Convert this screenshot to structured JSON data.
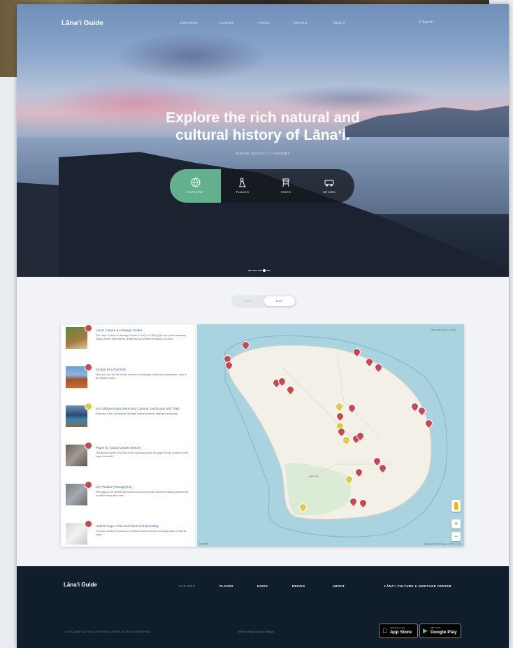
{
  "site": {
    "logo": "Lāna‘i Guide",
    "nav": [
      "Explore",
      "Places",
      "Hikes",
      "Drives",
      "About"
    ],
    "search_placeholder": "Search"
  },
  "hero": {
    "title_line1": "Explore the rich natural and",
    "title_line2": "cultural history of Lāna‘i.",
    "subtitle": "Please select a category",
    "tabs": [
      {
        "label": "Explore",
        "icon": "globe-icon",
        "active": true
      },
      {
        "label": "Places",
        "icon": "person-pin-icon",
        "active": false
      },
      {
        "label": "Hikes",
        "icon": "hiking-icon",
        "active": false
      },
      {
        "label": "Drives",
        "icon": "jeep-icon",
        "active": false
      }
    ],
    "slides_count": 5,
    "active_slide": 3
  },
  "view_toggle": {
    "options": [
      "List",
      "Map"
    ],
    "selected": "Map"
  },
  "places_list": [
    {
      "title": "Lāna‘i Culture & Heritage Center",
      "description": "The Lāna‘i Culture & Heritage Center (LCHC) is a 501(c)(3) non-profit community history center that collects, preserves and shares the history of Lāna‘i.",
      "badge": "red"
    },
    {
      "title": "Ka‘ōpū Koa Overlook",
      "description": "Here you can see the rusted remains of pineapple trucks and a panoramic view of the eastern slope.",
      "badge": "red"
    },
    {
      "title": "Ka Lokelani Kapu (Keomoku Cultural Landscape and Trail)",
      "description": "Keomoku Kapu (Keomoku) Heritage Trail and historic fishpond landscape.",
      "badge": "yellow"
    },
    {
      "title": "Paper by (Gand Garden Beach)",
      "description": "The ancient game of Ke‘aki Lē‘ahu‘i (sports) use to be played at this location on the way to Kaunolū.",
      "badge": "red"
    },
    {
      "title": "Kiʻi Pōhaku (Petroglyphs)",
      "description": "Petroglyphs are etched into rocks to record important events or natural phenomena in places along the coast.",
      "badge": "red"
    },
    {
      "title": "Halēʻiki Kapu: Trail and Ruins and Boundary",
      "description": "This site contains remnants of a historic settlement and boundary walls of Halēʻiki Kapu.",
      "badge": "red"
    }
  ],
  "map": {
    "label": "Maunalei Gulch Forest",
    "town_label": "Lāna‘i City",
    "credit": "Map data ©2019 Google · Terms of Use",
    "google": "Google",
    "zoom_in": "+",
    "zoom_out": "−",
    "pins": [
      {
        "color": "red"
      },
      {
        "color": "red"
      },
      {
        "color": "red"
      },
      {
        "color": "red"
      },
      {
        "color": "red"
      },
      {
        "color": "red"
      },
      {
        "color": "red"
      },
      {
        "color": "red"
      },
      {
        "color": "yellow"
      },
      {
        "color": "red"
      },
      {
        "color": "red"
      },
      {
        "color": "yellow"
      },
      {
        "color": "red"
      },
      {
        "color": "red"
      },
      {
        "color": "red"
      },
      {
        "color": "red"
      },
      {
        "color": "red"
      },
      {
        "color": "red"
      },
      {
        "color": "yellow"
      },
      {
        "color": "red"
      },
      {
        "color": "red"
      },
      {
        "color": "red"
      },
      {
        "color": "red"
      },
      {
        "color": "yellow"
      },
      {
        "color": "red"
      },
      {
        "color": "red"
      },
      {
        "color": "red"
      }
    ]
  },
  "footer": {
    "logo": "Lāna‘i Guide",
    "links": [
      "Explore",
      "Places",
      "Hikes",
      "Drives",
      "About"
    ],
    "partner": "Lāna‘i Culture & Heritage Center",
    "copyright": "© 2019 LĀNA‘I CULTURE & HERITAGE CENTER. ALL RIGHTS RESERVED.",
    "credit": "Website design by Blue Startups",
    "app_store": {
      "small": "Download on the",
      "big": "App Store"
    },
    "google_play": {
      "small": "GET IT ON",
      "big": "Google Play"
    }
  },
  "colors": {
    "accent_green": "#62b08c",
    "pin_red": "#c9484f",
    "pin_yellow": "#d8cd45",
    "footer_bg": "#101e2c",
    "link_blue": "#2f64b5"
  }
}
